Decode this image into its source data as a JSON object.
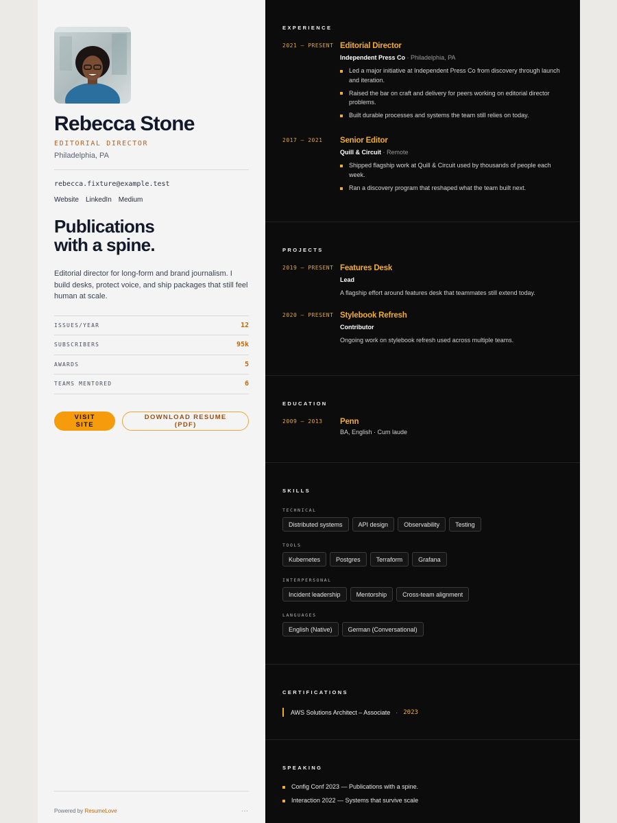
{
  "profile": {
    "name": "Rebecca Stone",
    "role": "EDITORIAL DIRECTOR",
    "location": "Philadelphia, PA",
    "email": "rebecca.fixture@example.test",
    "links": [
      "Website",
      "LinkedIn",
      "Medium"
    ],
    "headline_line1": "Publications",
    "headline_line2": "with a spine.",
    "bio": "Editorial director for long-form and brand journalism. I build desks, protect voice, and ship packages that still feel human at scale."
  },
  "stats": [
    {
      "label": "ISSUES/YEAR",
      "value": "12"
    },
    {
      "label": "SUBSCRIBERS",
      "value": "95k"
    },
    {
      "label": "AWARDS",
      "value": "5"
    },
    {
      "label": "TEAMS MENTORED",
      "value": "6"
    }
  ],
  "cta": {
    "primary": "VISIT SITE",
    "secondary": "DOWNLOAD RESUME (PDF)"
  },
  "footer": {
    "powered_by": "Powered by ",
    "brand": "ResumeLove",
    "menu": "···"
  },
  "experience": {
    "title": "EXPERIENCE",
    "items": [
      {
        "dates": "2021 — PRESENT",
        "title": "Editorial Director",
        "org": "Independent Press Co",
        "org_loc": " · Philadelphia, PA",
        "bullets": [
          "Led a major initiative at Independent Press Co from discovery through launch and iteration.",
          "Raised the bar on craft and delivery for peers working on editorial director problems.",
          "Built durable processes and systems the team still relies on today."
        ]
      },
      {
        "dates": "2017 — 2021",
        "title": "Senior Editor",
        "org": "Quill & Circuit",
        "org_loc": " · Remote",
        "bullets": [
          "Shipped flagship work at Quill & Circuit used by thousands of people each week.",
          "Ran a discovery program that reshaped what the team built next."
        ]
      }
    ]
  },
  "projects": {
    "title": "PROJECTS",
    "items": [
      {
        "dates": "2019 — PRESENT",
        "title": "Features Desk",
        "role": "Lead",
        "desc": "A flagship effort around features desk that teammates still extend today."
      },
      {
        "dates": "2020 — PRESENT",
        "title": "Stylebook Refresh",
        "role": "Contributor",
        "desc": "Ongoing work on stylebook refresh used across multiple teams."
      }
    ]
  },
  "education": {
    "title": "EDUCATION",
    "dates": "2009 — 2013",
    "school": "Penn",
    "degree": "BA, English · Cum laude"
  },
  "skills": {
    "title": "SKILLS",
    "groups": [
      {
        "label": "TECHNICAL",
        "items": [
          "Distributed systems",
          "API design",
          "Observability",
          "Testing"
        ]
      },
      {
        "label": "TOOLS",
        "items": [
          "Kubernetes",
          "Postgres",
          "Terraform",
          "Grafana"
        ]
      },
      {
        "label": "INTERPERSONAL",
        "items": [
          "Incident leadership",
          "Mentorship",
          "Cross-team alignment"
        ]
      },
      {
        "label": "LANGUAGES",
        "items": [
          "English (Native)",
          "German (Conversational)"
        ]
      }
    ]
  },
  "certifications": {
    "title": "CERTIFICATIONS",
    "name": "AWS Solutions Architect – Associate",
    "sep": "·",
    "year": "2023"
  },
  "speaking": {
    "title": "SPEAKING",
    "items": [
      "Config Conf 2023 — Publications with a spine.",
      "Interaction 2022 — Systems that survive scale"
    ]
  }
}
